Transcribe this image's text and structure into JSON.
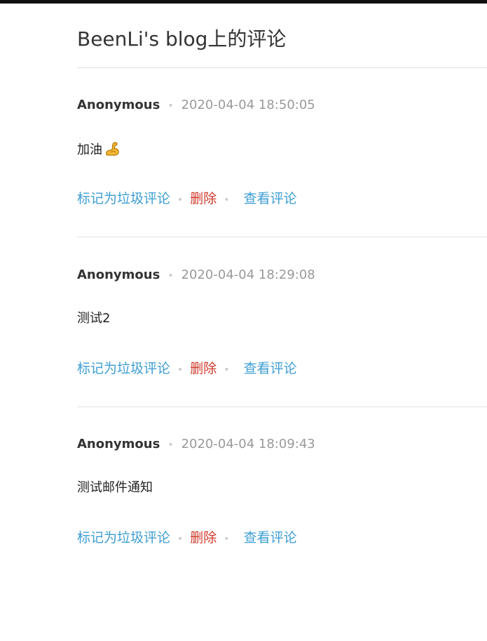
{
  "page": {
    "title": "BeenLi's blog上的评论"
  },
  "colors": {
    "link": "#3e9ed3",
    "delete": "#d0392b",
    "date": "#999999",
    "divider": "#e2e2e2"
  },
  "separator": "•",
  "comments": [
    {
      "author": "Anonymous",
      "date": "2020-04-04 18:50:05",
      "body": "加油",
      "body_icon": "flexed-biceps-emoji",
      "actions": {
        "spam": "标记为垃圾评论",
        "delete": "删除",
        "view": "查看评论"
      }
    },
    {
      "author": "Anonymous",
      "date": "2020-04-04 18:29:08",
      "body": "测试2",
      "actions": {
        "spam": "标记为垃圾评论",
        "delete": "删除",
        "view": "查看评论"
      }
    },
    {
      "author": "Anonymous",
      "date": "2020-04-04 18:09:43",
      "body": "测试邮件通知",
      "actions": {
        "spam": "标记为垃圾评论",
        "delete": "删除",
        "view": "查看评论"
      }
    }
  ]
}
